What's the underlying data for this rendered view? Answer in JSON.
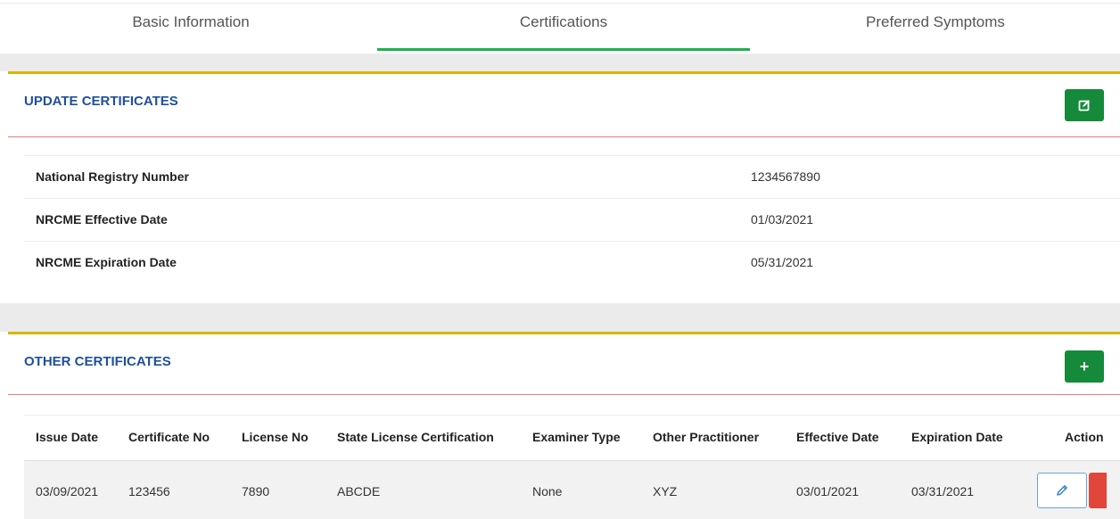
{
  "tabs": [
    {
      "label": "Basic Information"
    },
    {
      "label": "Certifications"
    },
    {
      "label": "Preferred Symptoms"
    }
  ],
  "update_section": {
    "title": "UPDATE CERTIFICATES",
    "button_icon": "edit-square-icon",
    "rows": [
      {
        "label": "National Registry Number",
        "value": "1234567890"
      },
      {
        "label": "NRCME Effective Date",
        "value": "01/03/2021"
      },
      {
        "label": "NRCME Expiration Date",
        "value": "05/31/2021"
      }
    ]
  },
  "other_section": {
    "title": "OTHER CERTIFICATES",
    "add_label": "+",
    "columns": [
      "Issue Date",
      "Certificate No",
      "License No",
      "State License Certification",
      "Examiner Type",
      "Other Practitioner",
      "Effective Date",
      "Expiration Date",
      "Action"
    ],
    "rows": [
      [
        "03/09/2021",
        "123456",
        "7890",
        "ABCDE",
        "None",
        "XYZ",
        "03/01/2021",
        "03/31/2021"
      ]
    ]
  },
  "colors": {
    "active_tab": "#1db04f",
    "section_border": "#d6b700",
    "title": "#1f4f9c",
    "button": "#158a3a",
    "delete": "#e0473a"
  }
}
